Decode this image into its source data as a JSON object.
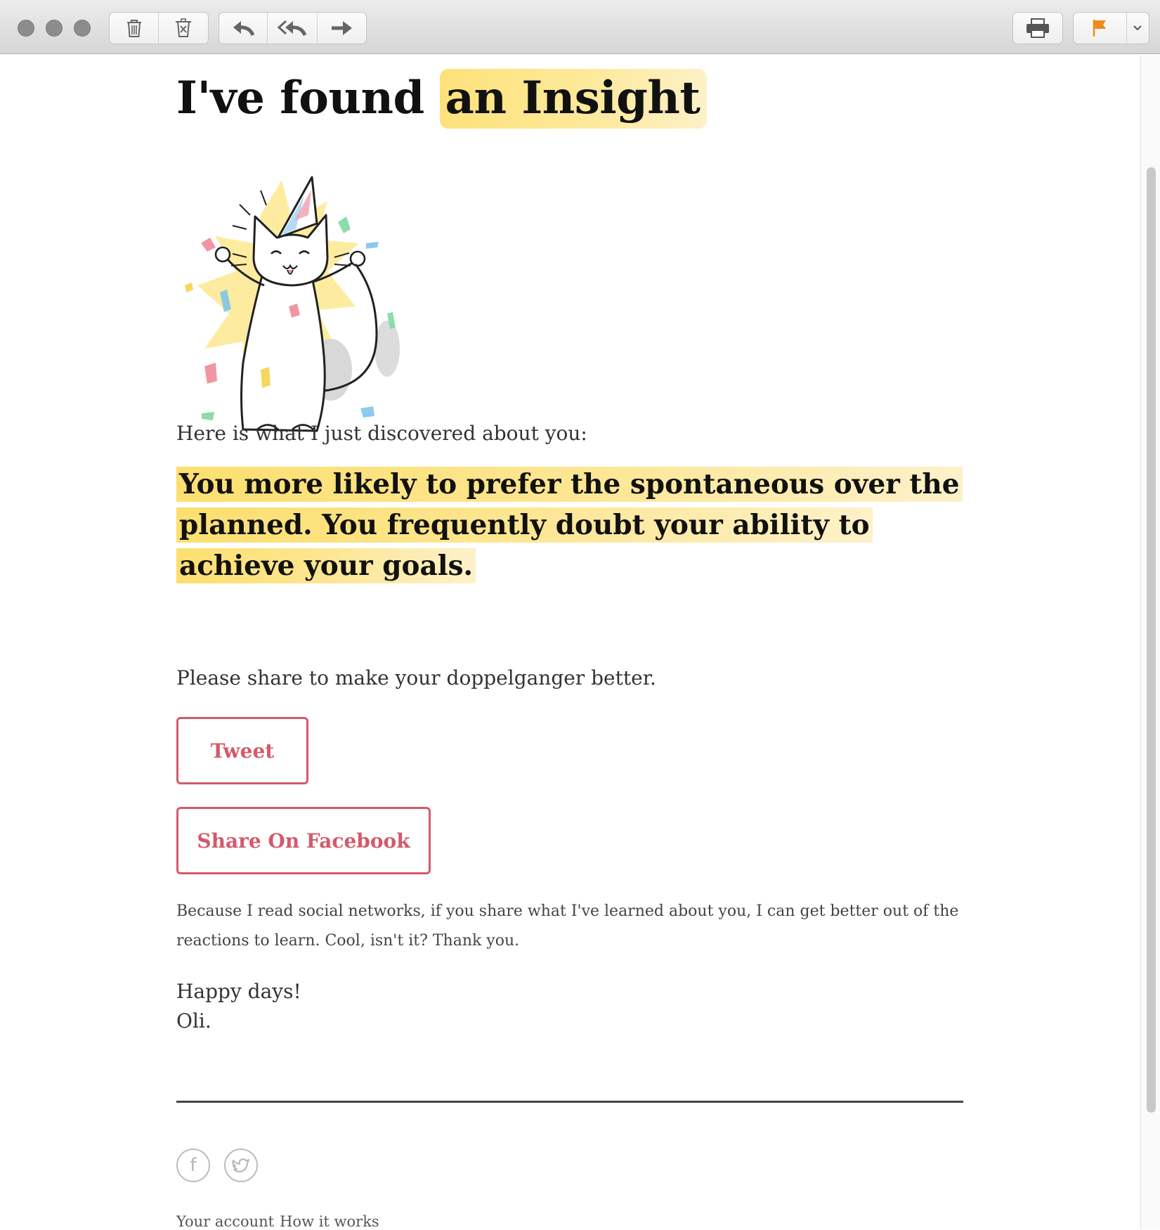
{
  "toolbar": {
    "buttons": [
      {
        "name": "trash",
        "icon": "trash-icon"
      },
      {
        "name": "junk",
        "icon": "junk-icon"
      },
      {
        "name": "reply",
        "icon": "reply-icon"
      },
      {
        "name": "reply-all",
        "icon": "reply-all-icon"
      },
      {
        "name": "forward",
        "icon": "forward-icon"
      },
      {
        "name": "print",
        "icon": "print-icon"
      },
      {
        "name": "flag",
        "icon": "flag-icon"
      }
    ],
    "flag_color": "#f08a1d"
  },
  "email": {
    "title_prefix": "I've found",
    "title_highlight": "an Insight",
    "intro": "Here is what I just discovered about you:",
    "insight": "You more likely to prefer the spontaneous over the planned. You frequently doubt your ability to achieve your goals.",
    "share_cta": "Please share to make your doppelganger better.",
    "tweet_label": "Tweet",
    "facebook_label": "Share On Facebook",
    "note": "Because I read social networks, if you share what I've learned about you, I can get better out of the reactions to learn. Cool, isn't it? Thank you.",
    "signoff_line1": "Happy days!",
    "signoff_line2": "Oli.",
    "footer_links": [
      "Your account",
      "How it works"
    ]
  },
  "colors": {
    "highlight": "#fde27a",
    "button_accent": "#d35a6b"
  }
}
